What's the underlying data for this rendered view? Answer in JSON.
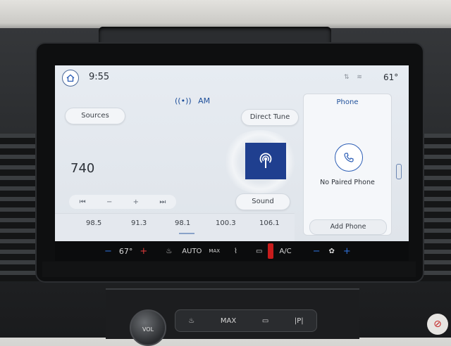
{
  "status_bar": {
    "time": "9:55",
    "outside_temp": "61°"
  },
  "source": {
    "band_label": "AM",
    "frequency": "740"
  },
  "buttons": {
    "sources_label": "Sources",
    "direct_tune_label": "Direct Tune",
    "sound_label": "Sound"
  },
  "tune_controls": [
    "⏮",
    "−",
    "+",
    "⏭"
  ],
  "presets": [
    "98.5",
    "91.3",
    "98.1",
    "100.3",
    "106.1"
  ],
  "phone": {
    "title": "Phone",
    "message": "No Paired Phone",
    "add_label": "Add Phone"
  },
  "climate": {
    "driver_temp": "67°",
    "auto_label": "AUTO",
    "max_label": "MAX",
    "ac_label": "A/C"
  },
  "hardware": {
    "vol_label": "VOL",
    "strip_labels": [
      "MAX",
      "|P|"
    ]
  },
  "icons": {
    "home": "home-icon",
    "am_radio": "broadcast-icon",
    "phone": "phone-icon",
    "station_art": "radio-tower-icon",
    "fan": "fan-icon"
  },
  "colors": {
    "accent": "#1e4f9a",
    "art_bg": "#1f3f8f",
    "heat": "#d93a3a",
    "cool": "#2f6fd6"
  }
}
